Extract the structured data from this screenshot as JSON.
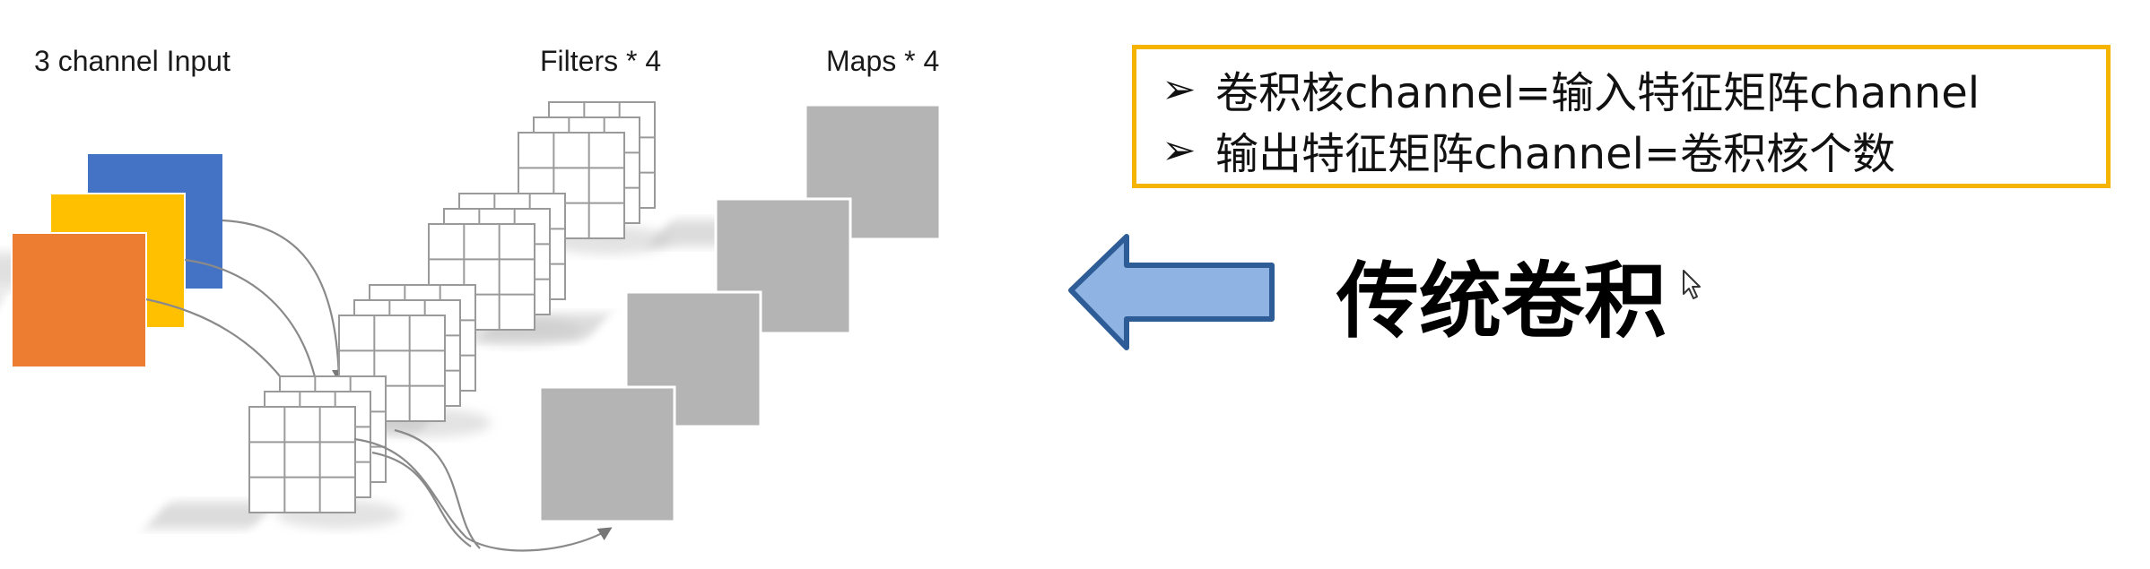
{
  "labels": {
    "input": "3 channel Input",
    "filters": "Filters * 4",
    "maps": "Maps * 4"
  },
  "info_box": {
    "bullets": [
      "卷积核channel=输入特征矩阵channel",
      "输出特征矩阵channel=卷积核个数"
    ]
  },
  "title": "传统卷积",
  "colors": {
    "channel_blue": "#4472c4",
    "channel_yellow": "#ffc000",
    "channel_orange": "#ed7d31",
    "map_gray": "#b4b4b4",
    "box_border": "#f4b400",
    "arrow_fill": "#8fb4e3",
    "arrow_stroke": "#2e5c96"
  },
  "icons": {
    "bullet": "arrowhead-bullet-icon",
    "pointer": "mouse-pointer-icon",
    "big_arrow": "left-arrow-icon"
  }
}
